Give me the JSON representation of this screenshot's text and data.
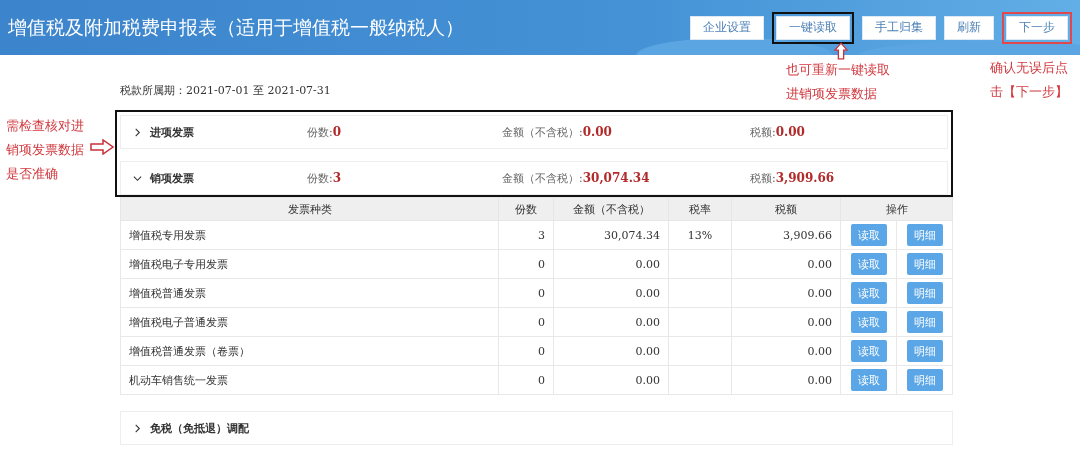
{
  "header": {
    "title": "增值税及附加税费申报表（适用于增值税一般纳税人）",
    "buttons": [
      {
        "label": "企业设置"
      },
      {
        "label": "一键读取",
        "color": "#111111"
      },
      {
        "label": "手工归集"
      },
      {
        "label": "刷新"
      },
      {
        "label": "下一步",
        "color": "#e0484d"
      }
    ]
  },
  "period": {
    "label": "税款所属期：",
    "value": "2021-07-01 至 2021-07-31"
  },
  "sections": [
    {
      "title": "进项发票",
      "expanded": false,
      "count_label": "份数:",
      "count": "0",
      "amount_label": "金额（不含税）:",
      "amount": "0.00",
      "tax_label": "税额:",
      "tax": "0.00"
    },
    {
      "title": "销项发票",
      "expanded": true,
      "count_label": "份数:",
      "count": "3",
      "amount_label": "金额（不含税）:",
      "amount": "30,074.34",
      "tax_label": "税额:",
      "tax": "3,909.66"
    }
  ],
  "table": {
    "columns": [
      "发票种类",
      "份数",
      "金额（不含税）",
      "税率",
      "税额",
      "操作"
    ],
    "rows": [
      {
        "type": "增值税专用发票",
        "count": "3",
        "amount": "30,074.34",
        "rate": "13%",
        "tax": "3,909.66",
        "actions": [
          "读取",
          "明细"
        ]
      },
      {
        "type": "增值税电子专用发票",
        "count": "0",
        "amount": "0.00",
        "tax": "0.00",
        "actions": [
          "读取",
          "明细"
        ]
      },
      {
        "type": "增值税普通发票",
        "count": "0",
        "amount": "0.00",
        "tax": "0.00",
        "actions": [
          "读取",
          "明细"
        ]
      },
      {
        "type": "增值税电子普通发票",
        "count": "0",
        "amount": "0.00",
        "tax": "0.00",
        "actions": [
          "读取",
          "明细"
        ]
      },
      {
        "type": "增值税普通发票（卷票）",
        "count": "0",
        "amount": "0.00",
        "tax": "0.00",
        "actions": [
          "读取",
          "明细"
        ]
      },
      {
        "type": "机动车销售统一发票",
        "count": "0",
        "amount": "0.00",
        "tax": "0.00",
        "actions": [
          "读取",
          "明细"
        ]
      }
    ]
  },
  "extra_section": {
    "title": "免税（免抵退）调配",
    "expanded": false
  },
  "annotations": {
    "left_note": [
      "需检查核对进",
      "销项发票数据",
      "是否准确"
    ],
    "button_note": [
      "也可重新一键读取",
      "进销项发票数据"
    ],
    "next_note": [
      "确认无误后点",
      "击【下一步】"
    ]
  }
}
